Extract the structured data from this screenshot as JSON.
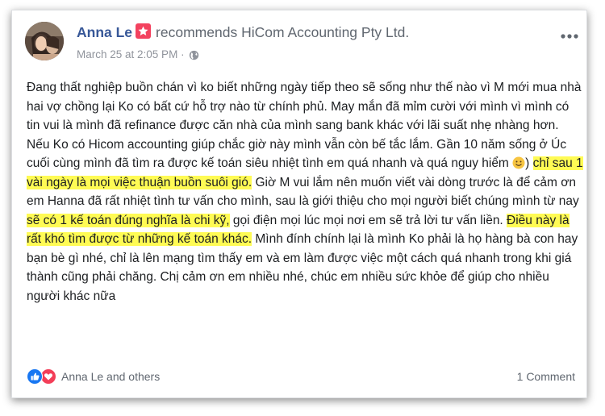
{
  "post": {
    "author": "Anna Le",
    "action": "recommends",
    "page": "HiCom Accounting Pty Ltd.",
    "timestamp": "March 25 at 2:05 PM",
    "separator": "·",
    "body": {
      "seg1": "Đang thất nghiệp buồn chán vì ko biết những ngày tiếp theo sẽ sống như thế nào vì M mới mua nhà hai vợ chồng lại Ko có bất cứ hỗ trợ nào từ chính phủ. May mắn đã mỉm cười với mình vì mình có tin vui là mình đã refinance được căn nhà của mình sang bank khác với lãi suất nhẹ nhàng hơn. Nếu Ko có Hicom accounting giúp chắc giờ này mình vẫn còn bế tắc lắm. Gần 10 năm sống ở Úc cuối cùng mình đã tìm ra được kế toán siêu nhiệt tình em quá nhanh và quá nguy hiểm",
      "seg2": ") ",
      "hl1": "chỉ sau 1 vài ngày là mọi việc thuận buồn suôi gió.",
      "seg3": " Giờ M vui lắm nên muốn viết vài dòng trước là để cảm ơn em Hanna đã rất nhiệt tình tư vấn cho mình, sau là giới thiệu cho mọi người biết chúng mình từ nay ",
      "hl2": "sẽ có 1 kế toán đúng nghĩa là chi kỹ,",
      "seg4": " gọi điện mọi lúc mọi nơi em sẽ trả lời tư vấn liền. ",
      "hl3": "Điều này là rất khó tìm được từ những kế toán khác.",
      "seg5": " Mình đính chính lại là mình Ko phải là họ hàng bà con hay bạn bè gì nhé, chỉ là lên mạng tìm thấy em và em làm được việc một cách quá nhanh trong khi giá thành cũng phải chăng. Chị cảm ơn em nhiều nhé, chúc em nhiều sức khỏe để giúp cho nhiều người khác nữa"
    },
    "reactions_text": "Anna Le and others",
    "comments_count": "1 Comment",
    "icons": {
      "recommend_badge": "star-icon",
      "privacy": "globe-icon",
      "more": "more-options-icon",
      "like": "like-icon",
      "love": "heart-icon",
      "emoji": "smiley-emoji-icon"
    },
    "colors": {
      "author": "#385898",
      "highlight": "#fffb54",
      "badge": "#f3425f",
      "like": "#1877f2",
      "love": "#f33e58"
    }
  }
}
